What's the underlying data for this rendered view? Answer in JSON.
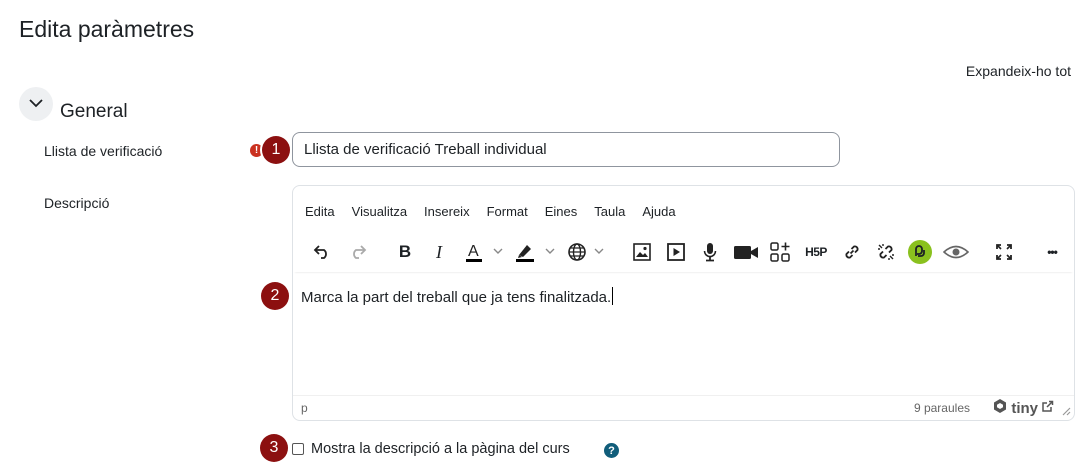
{
  "page": {
    "title": "Edita paràmetres",
    "expand_all": "Expandeix-ho tot"
  },
  "section": {
    "title": "General",
    "toggle_icon": "chevron-down-icon"
  },
  "fields": {
    "checklist": {
      "label": "Llista de verificació",
      "value": "Llista de verificació Treball individual",
      "required_mark": "!"
    },
    "description": {
      "label": "Descripció"
    }
  },
  "badges": [
    "1",
    "2",
    "3"
  ],
  "editor": {
    "menu": [
      "Edita",
      "Visualitza",
      "Insereix",
      "Format",
      "Eines",
      "Taula",
      "Ajuda"
    ],
    "toolbar": [
      "undo-icon",
      "redo-icon",
      "bold-icon",
      "italic-icon",
      "text-color-icon",
      "highlight-color-icon",
      "language-icon",
      "image-icon",
      "media-icon",
      "microphone-icon",
      "video-record-icon",
      "add-content-icon",
      "h5p-icon",
      "link-icon",
      "unlink-icon",
      "copilot-icon",
      "preview-icon",
      "fullscreen-icon",
      "more-icon"
    ],
    "toolbar_text": {
      "bold": "B",
      "italic": "I",
      "h5p": "H5P",
      "more": "•••"
    },
    "content": "Marca la part del treball que ja tens finalitzada.",
    "status": {
      "path": "p",
      "word_count": "9 paraules",
      "brand": "tiny"
    },
    "accent_color": "#8ac11e"
  },
  "show_description": {
    "label": "Mostra la descripció a la pàgina del curs",
    "checked": false,
    "help": "?"
  },
  "colors": {
    "badge": "#8c1010",
    "required": "#ca3120",
    "help": "#115d7a"
  }
}
